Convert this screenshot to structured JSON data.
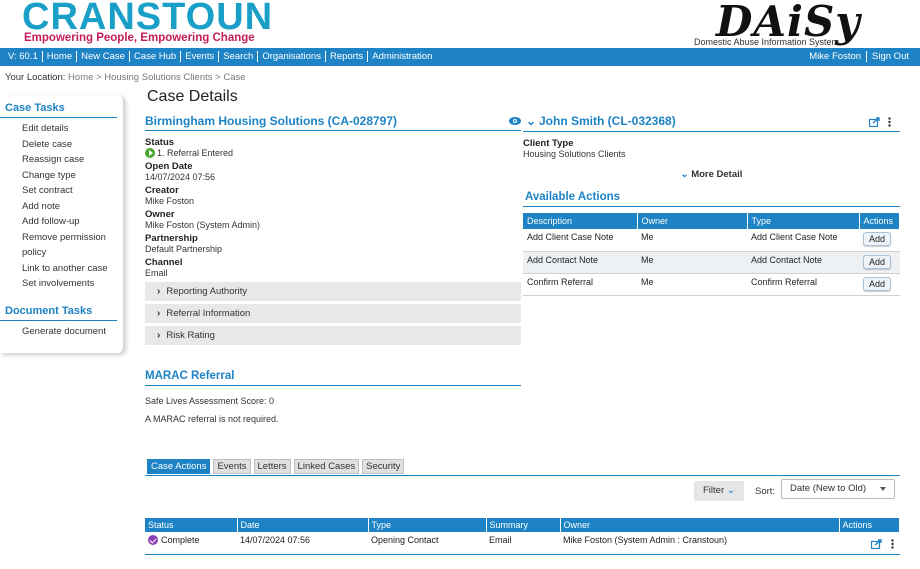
{
  "header": {
    "logo_left": "CRANSTOUN",
    "tagline": "Empowering People, Empowering Change",
    "logo_right": "DAiSy",
    "logo_right_sub": "Domestic Abuse Information System"
  },
  "nav": {
    "version": "V: 60.1",
    "items": [
      "Home",
      "New Case",
      "Case Hub",
      "Events",
      "Search",
      "Organisations",
      "Reports",
      "Administration"
    ],
    "user": "Mike Foston",
    "signout": "Sign Out"
  },
  "breadcrumb": {
    "label": "Your Location:",
    "crumbs": [
      "Home",
      "Housing Solutions Clients",
      "Case"
    ]
  },
  "sidebar": {
    "case_tasks_title": "Case Tasks",
    "case_tasks": [
      "Edit details",
      "Delete case",
      "Reassign case",
      "Change type",
      "Set contract",
      "Add note",
      "Add follow-up",
      "Remove permission",
      "policy",
      "Link to another case",
      "Set involvements"
    ],
    "doc_tasks_title": "Document Tasks",
    "doc_tasks": [
      "Generate document"
    ]
  },
  "page": {
    "title": "Case Details"
  },
  "case": {
    "heading": "Birmingham Housing Solutions (CA-028797)",
    "fields": [
      {
        "label": "Status",
        "value": "1. Referral Entered"
      },
      {
        "label": "Open Date",
        "value": "14/07/2024 07:56"
      },
      {
        "label": "Creator",
        "value": "Mike Foston"
      },
      {
        "label": "Owner",
        "value": "Mike Foston (System Admin)"
      },
      {
        "label": "Partnership",
        "value": "Default Partnership"
      },
      {
        "label": "Channel",
        "value": "Email"
      }
    ],
    "sections": [
      "Reporting Authority",
      "Referral Information",
      "Risk Rating"
    ]
  },
  "client": {
    "heading": "John Smith (CL-032368)",
    "type_label": "Client Type",
    "type_value": "Housing Solutions Clients",
    "more_detail": "More Detail"
  },
  "available_actions": {
    "title": "Available Actions",
    "columns": [
      "Description",
      "Owner",
      "Type",
      "Actions"
    ],
    "rows": [
      {
        "description": "Add Client Case Note",
        "owner": "Me",
        "type": "Add Client Case Note",
        "action": "Add"
      },
      {
        "description": "Add Contact Note",
        "owner": "Me",
        "type": "Add Contact Note",
        "action": "Add"
      },
      {
        "description": "Confirm Referral",
        "owner": "Me",
        "type": "Confirm Referral",
        "action": "Add"
      }
    ]
  },
  "marac": {
    "title": "MARAC Referral",
    "score": "Safe Lives Assessment Score: 0",
    "note": "A MARAC referral is not required."
  },
  "tabs": [
    "Case Actions",
    "Events",
    "Letters",
    "Linked Cases",
    "Security"
  ],
  "toolbar": {
    "filter": "Filter",
    "sort_label": "Sort:",
    "sort_value": "Date (New to Old)"
  },
  "events": {
    "columns": [
      "Status",
      "Date",
      "Type",
      "Summary",
      "Owner",
      "Actions"
    ],
    "rows": [
      {
        "status": "Complete",
        "date": "14/07/2024 07:56",
        "type": "Opening Contact",
        "summary": "Email",
        "owner": "Mike Foston (System Admin : Cranstoun)"
      }
    ]
  },
  "colors": {
    "primary": "#1d83c5",
    "brand_teal": "#1aa0c8",
    "brand_pink": "#c41d5c",
    "status_green": "#4aa52e",
    "complete_purple": "#8a3fb0"
  }
}
